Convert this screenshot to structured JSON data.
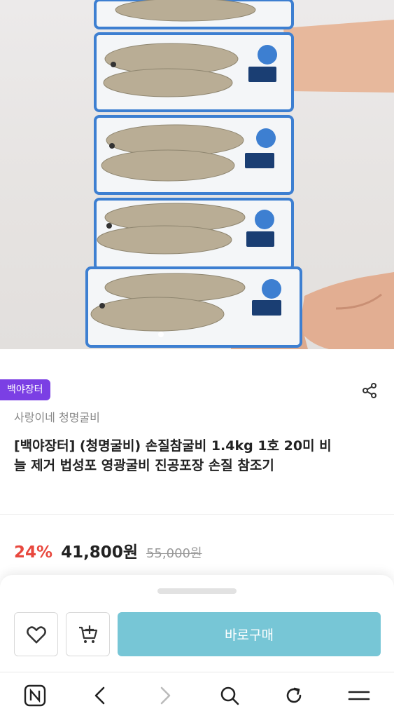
{
  "product": {
    "shop_badge": "백야장터",
    "seller_name": "사랑이네 청명굴비",
    "title": "[백야장터] (청명굴비) 손질참굴비 1.4kg 1호 20미 비늘 제거 법성포 영광굴비 진공포장 손질 참조기",
    "image_alt": "fish-pack-photo"
  },
  "price": {
    "discount_rate": "24%",
    "sale_price": "41,800원",
    "original_price": "55,000원"
  },
  "purchase": {
    "buy_now_label": "바로구매"
  },
  "colors": {
    "badge": "#7b3fe4",
    "discount": "#e8483e",
    "buy_button": "#77c6d6"
  },
  "icons": {
    "share": "share-icon",
    "wish": "heart-icon",
    "cart": "cart-add-icon",
    "nav": [
      "naver-home-icon",
      "back-icon",
      "forward-icon",
      "search-icon",
      "refresh-icon",
      "menu-icon"
    ]
  }
}
